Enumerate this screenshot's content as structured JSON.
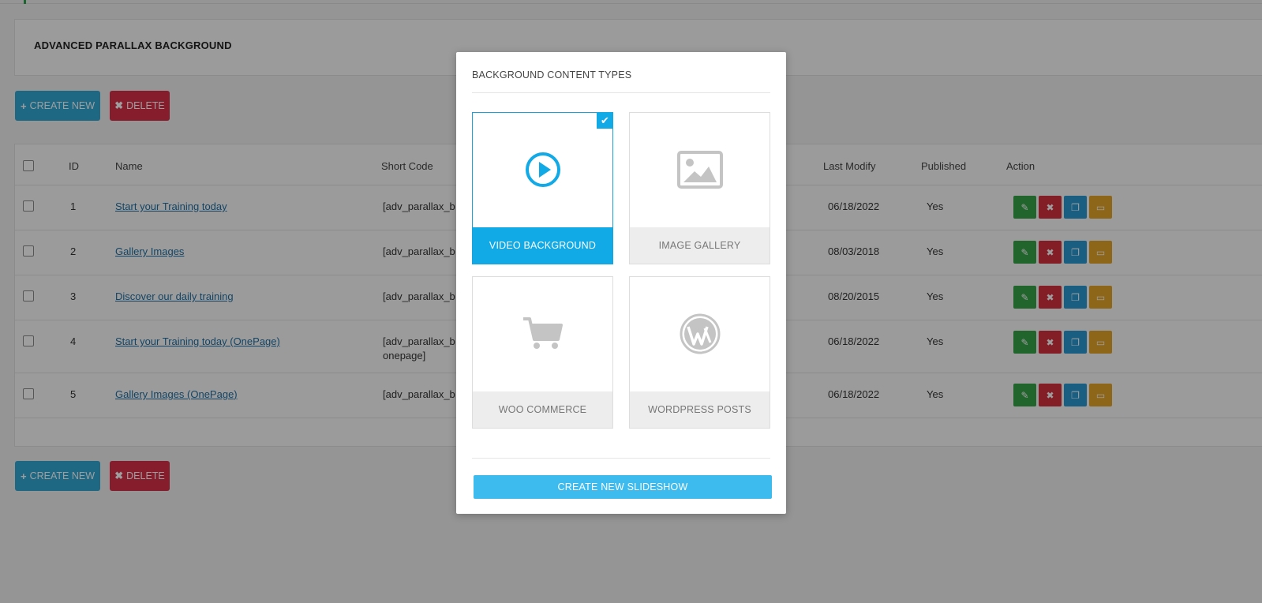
{
  "page": {
    "title": "ADVANCED PARALLAX BACKGROUND"
  },
  "toolbar": {
    "create_label": "CREATE NEW",
    "delete_label": "DELETE"
  },
  "table": {
    "headers": {
      "id": "ID",
      "name": "Name",
      "shortcode": "Short Code",
      "last_modify": "Last Modify",
      "published": "Published",
      "action": "Action"
    },
    "rows": [
      {
        "id": "1",
        "name": "Start your Training today",
        "shortcode": "[adv_parallax_b",
        "shortcode2": "",
        "last_modify": "06/18/2022",
        "published": "Yes"
      },
      {
        "id": "2",
        "name": "Gallery Images",
        "shortcode": "[adv_parallax_b",
        "shortcode2": "",
        "last_modify": "08/03/2018",
        "published": "Yes"
      },
      {
        "id": "3",
        "name": "Discover our daily training",
        "shortcode": "[adv_parallax_b",
        "shortcode2": "",
        "last_modify": "08/20/2015",
        "published": "Yes"
      },
      {
        "id": "4",
        "name": "Start your Training today (OnePage)",
        "shortcode": "[adv_parallax_b",
        "shortcode2": "onepage]",
        "last_modify": "06/18/2022",
        "published": "Yes"
      },
      {
        "id": "5",
        "name": "Gallery Images (OnePage)",
        "shortcode": "[adv_parallax_b",
        "shortcode2": "",
        "last_modify": "06/18/2022",
        "published": "Yes"
      }
    ]
  },
  "modal": {
    "title": "BACKGROUND CONTENT TYPES",
    "cards": [
      {
        "label": "VIDEO BACKGROUND",
        "icon": "play-icon",
        "selected": true
      },
      {
        "label": "IMAGE GALLERY",
        "icon": "image-icon",
        "selected": false
      },
      {
        "label": "WOO COMMERCE",
        "icon": "cart-icon",
        "selected": false
      },
      {
        "label": "WORDPRESS POSTS",
        "icon": "wordpress-icon",
        "selected": false
      }
    ],
    "submit_label": "CREATE NEW SLIDESHOW"
  },
  "colors": {
    "accent": "#11a9e6",
    "create_button": "#31a8d6",
    "delete_button": "#d9304a",
    "edit_action": "#36a34a",
    "delete_action": "#d32f3e",
    "copy_action": "#2b9ad2",
    "preview_action": "#e5a52a"
  }
}
